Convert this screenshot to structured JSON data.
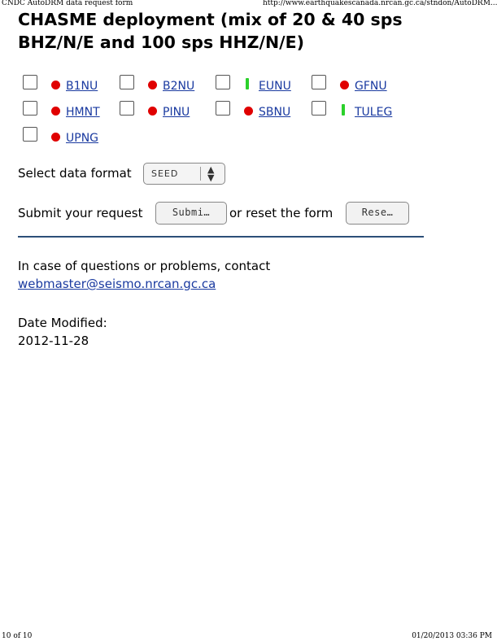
{
  "print_header": {
    "left": "CNDC AutoDRM data request form",
    "right": "http://www.earthquakescanada.nrcan.gc.ca/stndon/AutoDRM..."
  },
  "page": {
    "title": "CHASME deployment (mix of 20 & 40 sps BHZ/N/E and 100 sps HHZ/N/E)"
  },
  "stations": [
    {
      "code": "B1NU",
      "status": "red"
    },
    {
      "code": "B2NU",
      "status": "red"
    },
    {
      "code": "EUNU",
      "status": "green"
    },
    {
      "code": "GFNU",
      "status": "red"
    },
    {
      "code": "HMNT",
      "status": "red"
    },
    {
      "code": "PINU",
      "status": "red"
    },
    {
      "code": "SBNU",
      "status": "red"
    },
    {
      "code": "TULEG",
      "status": "green"
    },
    {
      "code": "UPNG",
      "status": "red"
    }
  ],
  "format": {
    "label": "Select data format",
    "selected": "SEED"
  },
  "submit": {
    "label": "Submit your request",
    "submit_button": "Submi…",
    "or_reset": "or reset the form",
    "reset_button": "Rese…"
  },
  "contact": {
    "text": "In case of questions or problems, contact",
    "email": "webmaster@seismo.nrcan.gc.ca"
  },
  "modified": {
    "label": "Date Modified:",
    "date": "2012-11-28"
  },
  "print_footer": {
    "page": "10 of 10",
    "timestamp": "01/20/2013 03:36 PM"
  },
  "colors": {
    "status_red": "#e00000",
    "status_green": "#2bd12b",
    "link": "#1a3aa0",
    "rule": "#2c4f78"
  }
}
